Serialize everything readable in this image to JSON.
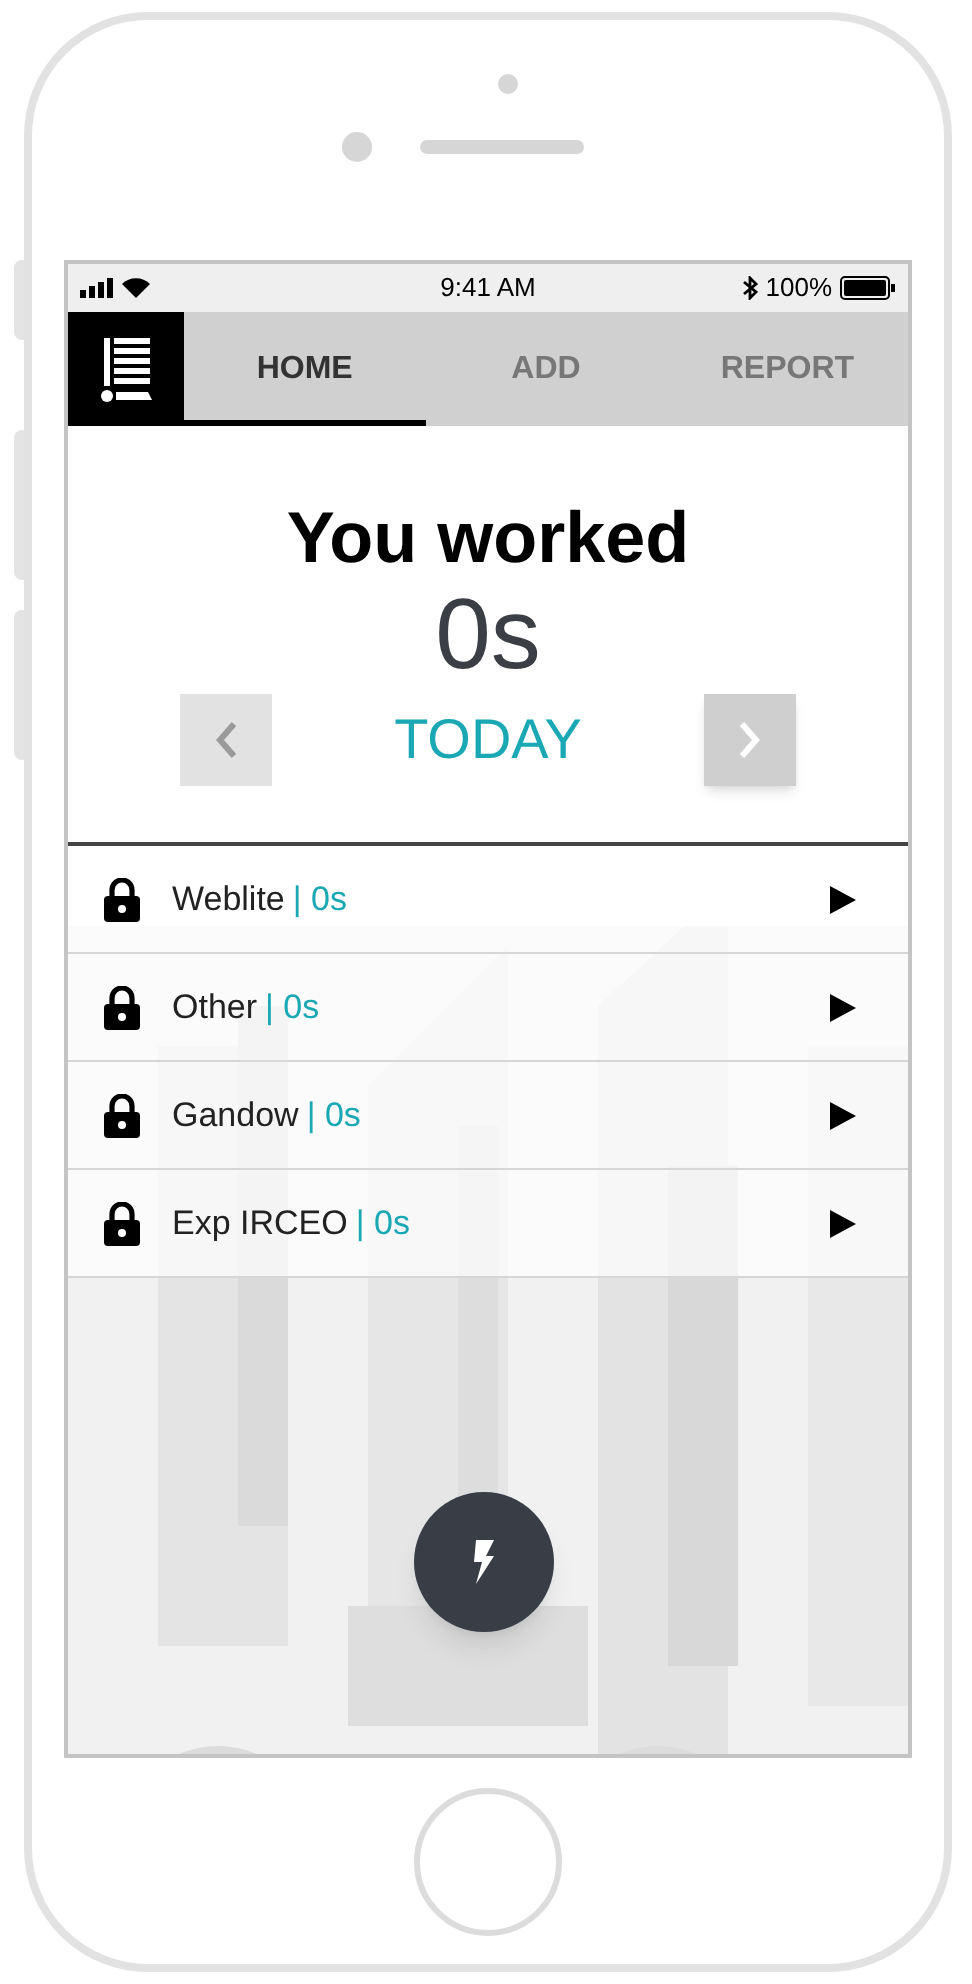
{
  "status_bar": {
    "time": "9:41 AM",
    "battery": "100%"
  },
  "tabs": [
    {
      "label": "HOME",
      "selected": true
    },
    {
      "label": "ADD",
      "selected": false
    },
    {
      "label": "REPORT",
      "selected": false
    }
  ],
  "summary": {
    "title": "You worked",
    "total": "0s",
    "period": "TODAY",
    "prev_disabled": true,
    "next_disabled": false
  },
  "projects": [
    {
      "name": "Weblite",
      "duration": "| 0s"
    },
    {
      "name": "Other",
      "duration": "| 0s"
    },
    {
      "name": "Gandow",
      "duration": "| 0s"
    },
    {
      "name": "Exp IRCEO",
      "duration": "| 0s"
    }
  ]
}
